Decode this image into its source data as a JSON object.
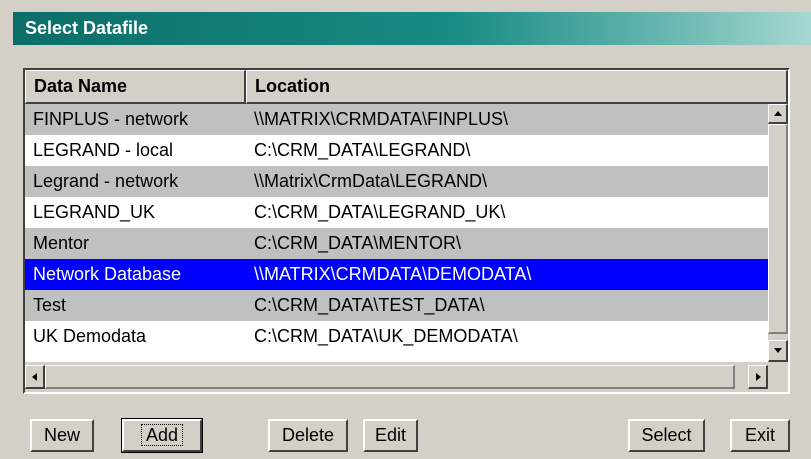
{
  "window": {
    "title": "Select Datafile"
  },
  "table": {
    "columns": [
      "Data Name",
      "Location"
    ],
    "rows": [
      {
        "name": "FINPLUS - network",
        "location": "\\\\MATRIX\\CRMDATA\\FINPLUS\\",
        "state": "normal"
      },
      {
        "name": "LEGRAND - local",
        "location": "C:\\CRM_DATA\\LEGRAND\\",
        "state": "normal"
      },
      {
        "name": "Legrand - network",
        "location": "\\\\Matrix\\CrmData\\LEGRAND\\",
        "state": "normal"
      },
      {
        "name": "LEGRAND_UK",
        "location": "C:\\CRM_DATA\\LEGRAND_UK\\",
        "state": "normal"
      },
      {
        "name": "Mentor",
        "location": "C:\\CRM_DATA\\MENTOR\\",
        "state": "normal"
      },
      {
        "name": "Network Database",
        "location": "\\\\MATRIX\\CRMDATA\\DEMODATA\\",
        "state": "selected"
      },
      {
        "name": "Test",
        "location": "C:\\CRM_DATA\\TEST_DATA\\",
        "state": "normal"
      },
      {
        "name": "UK Demodata",
        "location": "C:\\CRM_DATA\\UK_DEMODATA\\",
        "state": "normal"
      }
    ]
  },
  "buttons": {
    "new": "New",
    "add": "Add",
    "delete": "Delete",
    "edit": "Edit",
    "select": "Select",
    "exit": "Exit"
  },
  "colors": {
    "selection": "#0000ff",
    "row_alt": "#c0c0c0",
    "title_gradient_start": "#0c6e68",
    "face": "#d4d0c8"
  },
  "icons": {
    "scroll_up": "up-arrow",
    "scroll_down": "down-arrow",
    "scroll_left": "left-arrow",
    "scroll_right": "right-arrow"
  }
}
